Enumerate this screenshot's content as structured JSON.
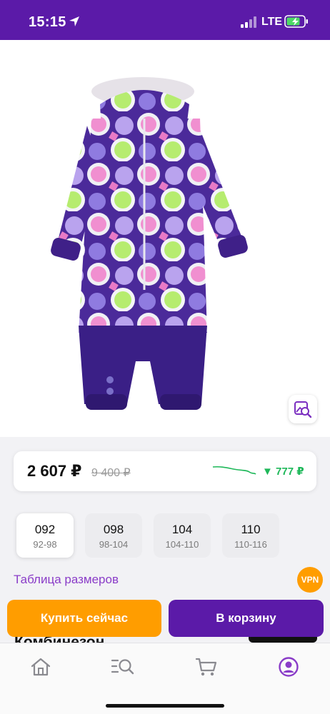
{
  "status_bar": {
    "time": "15:15",
    "network": "LTE"
  },
  "price": {
    "current": "2 607 ₽",
    "old": "9 400 ₽",
    "drop": "▼ 777 ₽",
    "drop_color": "#1fb85a"
  },
  "sizes": [
    {
      "code": "092",
      "range": "92-98",
      "selected": true
    },
    {
      "code": "098",
      "range": "98-104",
      "selected": false
    },
    {
      "code": "104",
      "range": "104-110",
      "selected": false
    },
    {
      "code": "110",
      "range": "110-116",
      "selected": false
    }
  ],
  "size_table_link": "Таблица размеров",
  "vpn_badge": "VPN",
  "actions": {
    "buy_now": "Купить сейчас",
    "add_to_cart": "В корзину"
  },
  "product_title": "Комбинезон",
  "tabs": [
    {
      "icon": "home-icon",
      "active": false
    },
    {
      "icon": "catalog-search-icon",
      "active": false
    },
    {
      "icon": "cart-icon",
      "active": false
    },
    {
      "icon": "profile-icon",
      "active": true
    }
  ],
  "colors": {
    "brand_purple": "#5b1aa8",
    "accent_orange": "#ff9d00",
    "link_purple": "#8a3cc8"
  }
}
